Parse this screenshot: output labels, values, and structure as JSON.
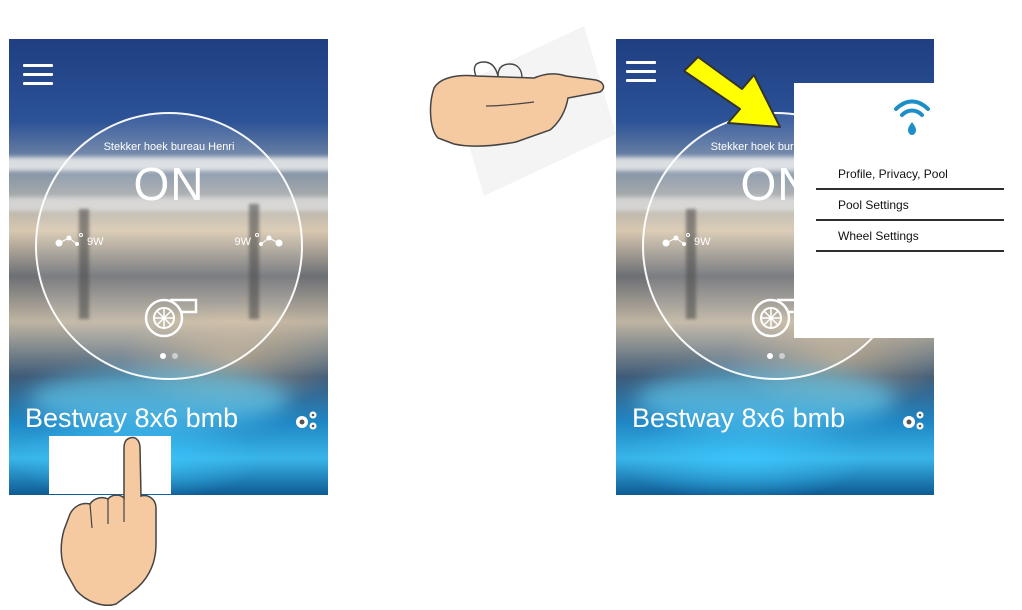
{
  "left_screen": {
    "dial": {
      "device_name": "Stekker hoek bureau Henri",
      "state": "ON",
      "power_left": "9W",
      "power_right": "9W"
    },
    "pool_name": "Bestway 8x6 bmb"
  },
  "right_screen": {
    "dial": {
      "device_name": "Stekker hoek bureau Henri",
      "state": "ON",
      "power_left": "9W"
    },
    "pool_name": "Bestway 8x6 bmb",
    "dropdown": {
      "items": [
        {
          "label": "Profile, Privacy, Pool"
        },
        {
          "label": "Pool Settings"
        },
        {
          "label": "Wheel Settings"
        }
      ]
    }
  },
  "colors": {
    "wifi_accent": "#1c8fc7",
    "arrow_fill": "#ffff00",
    "skin": "#f6caa0"
  },
  "icons": [
    "menu-icon",
    "wifi-icon",
    "gears-icon",
    "pump-icon",
    "molecule-icon",
    "pointing-hand-icon",
    "arrow-icon"
  ]
}
